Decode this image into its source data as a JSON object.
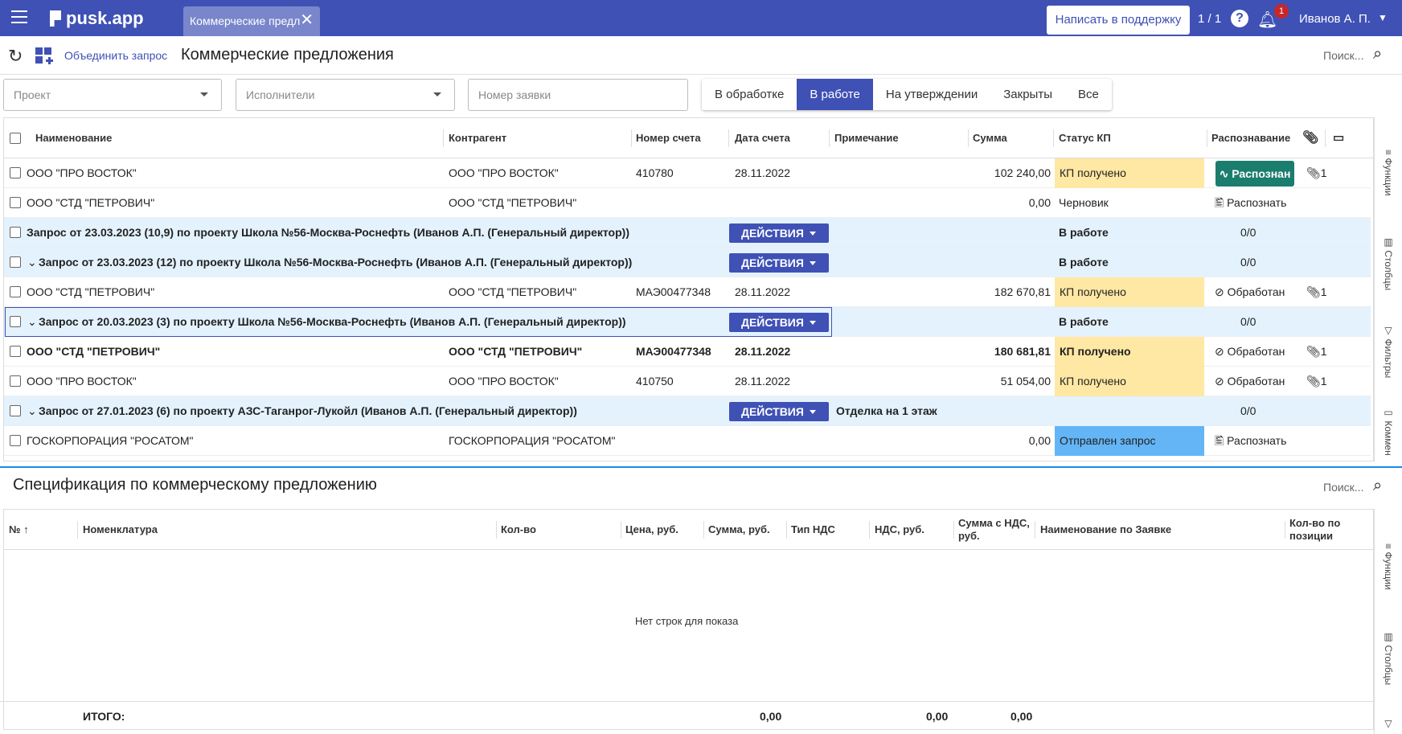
{
  "app": {
    "logo_text": "pusk.app",
    "tab_label": "Коммерческие предл",
    "support_button": "Написать в поддержку",
    "counter": "1 / 1",
    "notification_count": "1",
    "user_name": "Иванов А. П."
  },
  "toolbar": {
    "merge_label": "Объединить запрос",
    "title": "Коммерческие предложения",
    "search_label": "Поиск..."
  },
  "filters": {
    "project_placeholder": "Проект",
    "executors_placeholder": "Исполнители",
    "request_number_placeholder": "Номер заявки"
  },
  "status_tabs": [
    "В обработке",
    "В работе",
    "На утверждении",
    "Закрыты",
    "Все"
  ],
  "grid": {
    "columns": [
      "Наименование",
      "Контрагент",
      "Номер счета",
      "Дата счета",
      "Примечание",
      "Сумма",
      "Статус КП",
      "Распознавание"
    ],
    "rows": [
      {
        "name": "ООО \"ПРО ВОСТОК\"",
        "contractor": "ООО \"ПРО ВОСТОК\"",
        "invoice": "410780",
        "date": "28.11.2022",
        "note": "",
        "sum": "102 240,00",
        "status": "КП получено",
        "recog": "Распознан",
        "attach": "1"
      },
      {
        "name": "ООО \"СТД \"ПЕТРОВИЧ\"",
        "contractor": "ООО \"СТД \"ПЕТРОВИЧ\"",
        "invoice": "",
        "date": "",
        "note": "",
        "sum": "0,00",
        "status": "Черновик",
        "recog": "Распознать",
        "attach": ""
      },
      {
        "group": "Запрос от 23.03.2023 (10,9) по проекту Школа №56-Москва-Роснефть (Иванов А.П. (Генеральный директор))",
        "action": "ДЕЙСТВИЯ",
        "status": "В работе",
        "count": "0/0"
      },
      {
        "group": "Запрос от 23.03.2023 (12) по проекту Школа №56-Москва-Роснефть (Иванов А.П. (Генеральный директор))",
        "action": "ДЕЙСТВИЯ",
        "status": "В работе",
        "count": "0/0"
      },
      {
        "name": "ООО \"СТД \"ПЕТРОВИЧ\"",
        "contractor": "ООО \"СТД \"ПЕТРОВИЧ\"",
        "invoice": "МАЭ00477348",
        "date": "28.11.2022",
        "note": "",
        "sum": "182 670,81",
        "status": "КП получено",
        "recog": "Обработан",
        "attach": "1"
      },
      {
        "group": "Запрос от 20.03.2023 (3) по проекту Школа №56-Москва-Роснефть (Иванов А.П. (Генеральный директор))",
        "action": "ДЕЙСТВИЯ",
        "status": "В работе",
        "count": "0/0"
      },
      {
        "name": "ООО \"СТД \"ПЕТРОВИЧ\"",
        "contractor": "ООО \"СТД \"ПЕТРОВИЧ\"",
        "invoice": "МАЭ00477348",
        "date": "28.11.2022",
        "note": "",
        "sum": "180 681,81",
        "status": "КП получено",
        "recog": "Обработан",
        "attach": "1"
      },
      {
        "name": "ООО \"ПРО ВОСТОК\"",
        "contractor": "ООО \"ПРО ВОСТОК\"",
        "invoice": "410750",
        "date": "28.11.2022",
        "note": "",
        "sum": "51 054,00",
        "status": "КП получено",
        "recog": "Обработан",
        "attach": "1"
      },
      {
        "group": "Запрос от 27.01.2023 (6) по проекту АЗС-Таганрог-Лукойл (Иванов А.П. (Генеральный директор))",
        "action": "ДЕЙСТВИЯ",
        "note": "Отделка на 1 этаж",
        "status": "",
        "count": "0/0"
      },
      {
        "name": "ГОСКОРПОРАЦИЯ \"РОСАТОМ\"",
        "contractor": "ГОСКОРПОРАЦИЯ \"РОСАТОМ\"",
        "invoice": "",
        "date": "",
        "note": "",
        "sum": "0,00",
        "status": "Отправлен запрос",
        "recog": "Распознать",
        "attach": ""
      }
    ]
  },
  "side_tabs_top": [
    "Функции",
    "Столбцы",
    "Фильтры",
    "Коммен"
  ],
  "spec": {
    "title": "Спецификация по коммерческому предложению",
    "search_label": "Поиск...",
    "columns": [
      "№",
      "Номенклатура",
      "Кол-во",
      "Цена, руб.",
      "Сумма, руб.",
      "Тип НДС",
      "НДС, руб.",
      "Сумма с НДС, руб.",
      "Наименование по Заявке",
      "Кол-во по позиции"
    ],
    "empty_text": "Нет строк для показа",
    "totals_label": "ИТОГО:",
    "totals": [
      "0,00",
      "0,00",
      "0,00"
    ]
  },
  "side_tabs_bottom": [
    "Функции",
    "Столбцы"
  ]
}
